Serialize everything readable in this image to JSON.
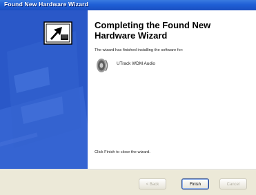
{
  "window": {
    "title": "Found New Hardware Wizard"
  },
  "main": {
    "heading": "Completing the Found New Hardware Wizard",
    "intro": "The wizard has finished installing the software for:",
    "device": {
      "name": "UTrack WDM Audio",
      "icon": "speaker-icon"
    },
    "close_hint": "Click Finish to close the wizard."
  },
  "buttons": {
    "back": "< Back",
    "finish": "Finish",
    "cancel": "Cancel"
  },
  "colors": {
    "titlebar": "#1f5fd6",
    "side_panel": "#2a58c8",
    "dialog_bg": "#ece9d8"
  }
}
